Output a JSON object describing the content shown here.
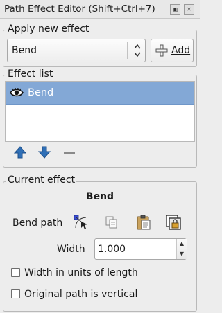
{
  "window": {
    "title": "Path Effect Editor (Shift+Ctrl+7)",
    "buttons": [
      "restore-icon",
      "close-icon"
    ]
  },
  "apply_new": {
    "legend": "Apply new effect",
    "selected_effect": "Bend",
    "add_label": "Add"
  },
  "effect_list": {
    "legend": "Effect list",
    "items": [
      {
        "label": "Bend",
        "visible": true,
        "selected": true
      }
    ],
    "toolbar": [
      "raise-effect-icon",
      "lower-effect-icon",
      "remove-effect-icon"
    ]
  },
  "current_effect": {
    "legend": "Current effect",
    "name": "Bend",
    "bend_path_label": "Bend path",
    "bend_path_tools": [
      "edit-on-canvas-icon",
      "copy-path-icon",
      "paste-path-icon",
      "link-to-path-icon"
    ],
    "width_label": "Width",
    "width_value": "1.000",
    "options": [
      {
        "label": "Width in units of length",
        "checked": false
      },
      {
        "label": "Original path is vertical",
        "checked": false
      }
    ]
  },
  "colors": {
    "selection": "#83a8d6",
    "arrow_blue": "#2f6fb6",
    "node_blue": "#3b4fd6"
  }
}
